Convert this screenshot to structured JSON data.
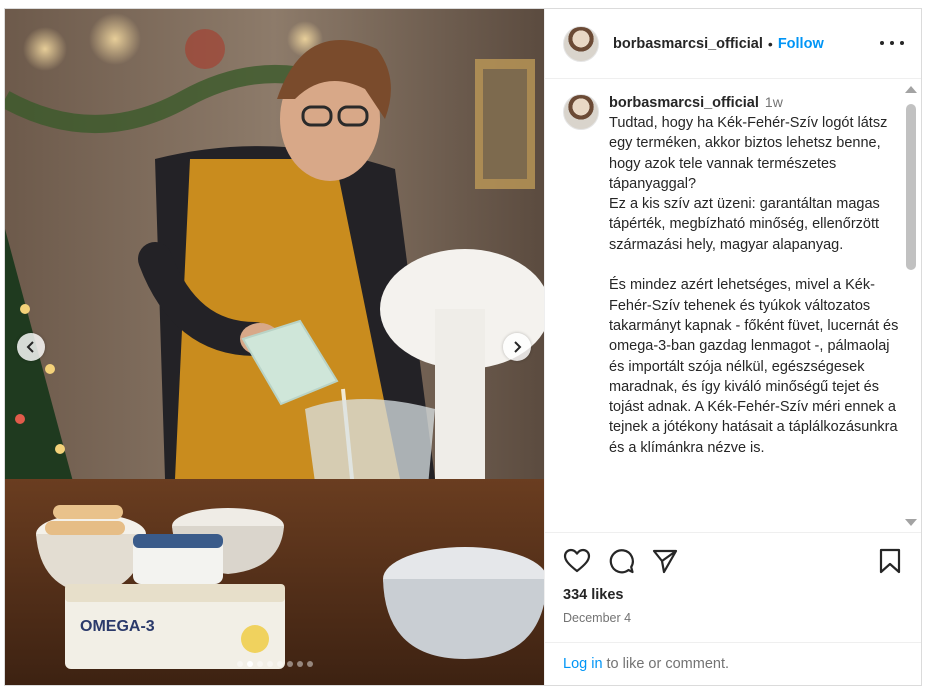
{
  "post": {
    "media": {
      "alt_scene": "photo",
      "carousel": {
        "total_slides": 8,
        "active_index": 1
      },
      "egg_box_label": "OMEGA-3",
      "prev_icon": "chevron-left-icon",
      "next_icon": "chevron-right-icon"
    },
    "header": {
      "username": "borbasmarcsi_official",
      "separator": "•",
      "follow_label": "Follow",
      "more_icon": "more-options-icon"
    },
    "caption": {
      "username": "borbasmarcsi_official",
      "time": "1w",
      "text": "Tudtad, hogy ha Kék-Fehér-Szív logót látsz egy terméken, akkor biztos lehetsz benne, hogy azok tele vannak természetes tápanyaggal?\nEz a kis szív azt üzeni: garantáltan magas tápérték, megbízható minőség, ellenőrzött származási hely, magyar alapanyag.\n\nÉs mindez azért lehetséges, mivel a Kék-Fehér-Szív tehenek és tyúkok változatos takarmányt kapnak - főként füvet, lucernát és omega-3-ban gazdag lenmagot -, pálmaolaj és importált szója nélkül, egészségesek maradnak, és így kiváló minőségű tejet és tojást adnak. A Kék-Fehér-Szív méri ennek a tejnek a jótékony hatásait a táplálkozásunkra és a klímánkra nézve is."
    },
    "actions": {
      "like_icon": "heart-icon",
      "comment_icon": "comment-icon",
      "share_icon": "share-icon",
      "save_icon": "bookmark-icon",
      "likes": "334 likes",
      "date": "December 4"
    },
    "login": {
      "link_label": "Log in",
      "rest_label": "to like or comment."
    },
    "colors": {
      "link": "#0095f6",
      "text": "#262626",
      "muted": "#737373",
      "border": "#dbdbdb"
    }
  }
}
